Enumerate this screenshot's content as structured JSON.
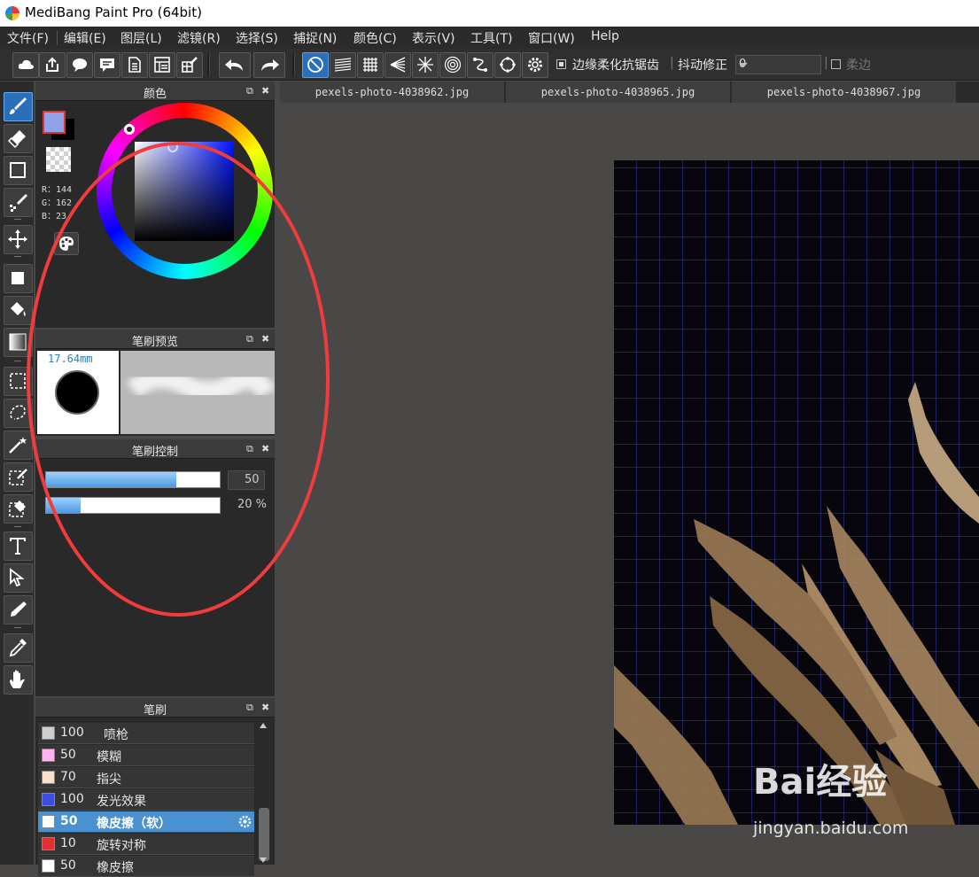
{
  "window": {
    "title": "MediBang Paint Pro (64bit)"
  },
  "menu": [
    "文件(F)",
    "编辑(E)",
    "图层(L)",
    "滤镜(R)",
    "选择(S)",
    "捕捉(N)",
    "颜色(C)",
    "表示(V)",
    "工具(T)",
    "窗口(W)",
    "Help"
  ],
  "toolbar": {
    "antialias_label": "边缘柔化抗锯齿",
    "antialias_checked": true,
    "stabilizer_label": "抖动修正",
    "stabilizer_value": "0",
    "soft_edge_label": "柔边",
    "soft_edge_checked": false
  },
  "color_panel": {
    "title": "颜色",
    "foreground": "#90a2ea",
    "r": "R：144",
    "g": "G：162",
    "b": "B：23"
  },
  "brush_preview": {
    "title": "笔刷预览",
    "size": "17.64mm"
  },
  "brush_control": {
    "title": "笔刷控制",
    "size_value": "50",
    "opacity_value": "20 %",
    "size_level": 0.75,
    "opacity_level": 0.2
  },
  "brush_list": {
    "title": "笔刷",
    "items": [
      {
        "size": "100",
        "name": "喷枪",
        "color": "#cfcfcf"
      },
      {
        "size": "50",
        "name": "模糊",
        "color": "#ffb3f0"
      },
      {
        "size": "70",
        "name": "指尖",
        "color": "#fde0cc"
      },
      {
        "size": "100",
        "name": "发光效果",
        "color": "#3a4ee0"
      },
      {
        "size": "50",
        "name": "橡皮擦（软）",
        "color": "#ffffff",
        "selected": true
      },
      {
        "size": "10",
        "name": "旋转对称",
        "color": "#e03030"
      },
      {
        "size": "50",
        "name": "橡皮擦",
        "color": "#ffffff"
      }
    ]
  },
  "tabs": [
    "pexels-photo-4038962.jpg",
    "pexels-photo-4038965.jpg",
    "pexels-photo-4038967.jpg"
  ],
  "watermark": {
    "brand": "Bai经验",
    "url": "jingyan.baidu.com"
  }
}
